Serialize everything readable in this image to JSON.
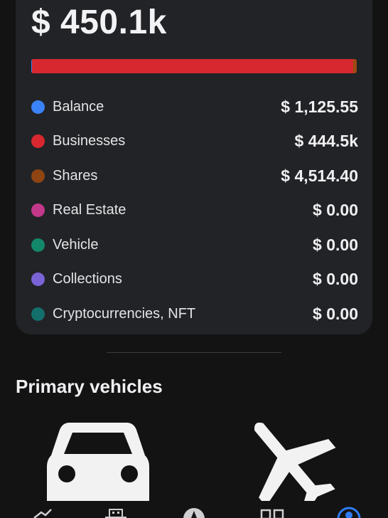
{
  "summary": {
    "total": "$ 450.1k",
    "bar": [
      {
        "name": "Balance",
        "fraction": 0.0025,
        "color": "#3a82f7"
      },
      {
        "name": "Businesses",
        "fraction": 0.9875,
        "color": "#d7282f"
      },
      {
        "name": "Shares",
        "fraction": 0.01,
        "color": "#9b4a12"
      }
    ]
  },
  "categories": [
    {
      "label": "Balance",
      "value": "$ 1,125.55",
      "color": "#3a82f7"
    },
    {
      "label": "Businesses",
      "value": "$ 444.5k",
      "color": "#d7282f"
    },
    {
      "label": "Shares",
      "value": "$ 4,514.40",
      "color": "#8e4511"
    },
    {
      "label": "Real Estate",
      "value": "$ 0.00",
      "color": "#c2388a"
    },
    {
      "label": "Vehicle",
      "value": "$ 0.00",
      "color": "#12876a"
    },
    {
      "label": "Collections",
      "value": "$ 0.00",
      "color": "#7a63d6"
    },
    {
      "label": "Cryptocurrencies, NFT",
      "value": "$ 0.00",
      "color": "#136f6c"
    }
  ],
  "primary_vehicles": {
    "title": "Primary vehicles",
    "items": [
      {
        "icon": "car-icon"
      },
      {
        "icon": "airplane-icon"
      }
    ]
  },
  "bottom_nav": {
    "items": [
      {
        "icon": "chart-icon"
      },
      {
        "icon": "building-icon"
      },
      {
        "icon": "compass-icon"
      },
      {
        "icon": "grid-icon"
      },
      {
        "icon": "profile-icon",
        "active": true,
        "color": "#2f7cf6"
      }
    ]
  }
}
